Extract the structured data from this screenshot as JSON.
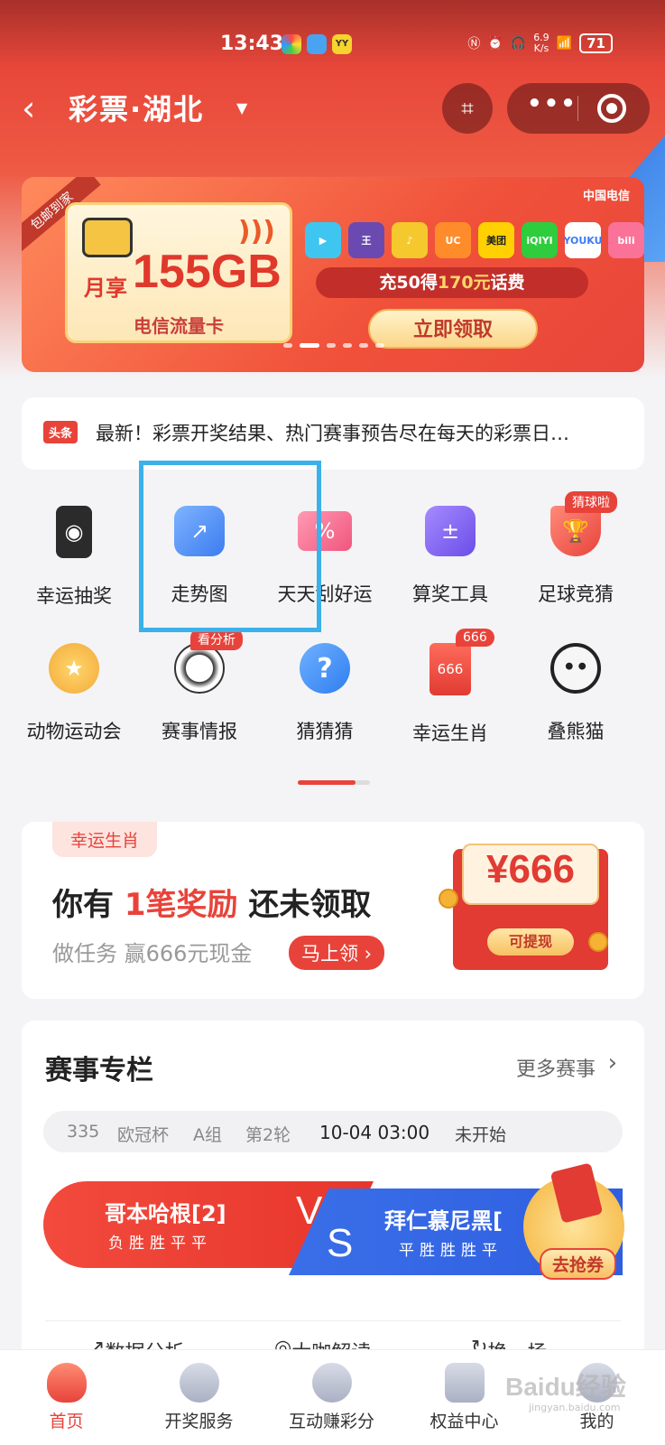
{
  "status_bar": {
    "time": "13:43",
    "net_speed": "6.9",
    "net_unit": "K/s",
    "battery": "71"
  },
  "nav": {
    "title": "彩票·湖北"
  },
  "banner": {
    "ribbon": "包邮到家",
    "monthly": "月享",
    "data_amount": "155GB",
    "card_name": "电信流量卡",
    "carrier": "中国电信",
    "apps": [
      "腾讯视频",
      "王者",
      "QQ音乐",
      "UC",
      "美团",
      "爱奇艺",
      "优酷",
      "bilibili"
    ],
    "promo_prefix": "充50得",
    "promo_highlight": "170元",
    "promo_suffix": "话费",
    "cta": "立即领取"
  },
  "headline": {
    "tag": "头条",
    "text": "最新！彩票开奖结果、热门赛事预告尽在每天的彩票日…"
  },
  "grid": [
    {
      "label": "幸运抽奖",
      "icon": "phone-icon",
      "color": "#2b2b2b"
    },
    {
      "label": "走势图",
      "icon": "trend-chart-icon",
      "color": "#4f8ff0"
    },
    {
      "label": "天天刮好运",
      "icon": "scratch-card-icon",
      "color": "#f06a8a"
    },
    {
      "label": "算奖工具",
      "icon": "calculator-icon",
      "color": "#7a5cf0"
    },
    {
      "label": "足球竞猜",
      "icon": "trophy-icon",
      "color": "#e8433a",
      "badge": "猜球啦"
    },
    {
      "label": "动物运动会",
      "icon": "medal-icon",
      "color": "#f3a93a"
    },
    {
      "label": "赛事情报",
      "icon": "soccer-ball-icon",
      "color": "#333333",
      "badge": "看分析"
    },
    {
      "label": "猜猜猜",
      "icon": "question-icon",
      "color": "#3a8ff0"
    },
    {
      "label": "幸运生肖",
      "icon": "red-packet-icon",
      "color": "#e8433a",
      "badge": "666",
      "inner": "666"
    },
    {
      "label": "叠熊猫",
      "icon": "panda-icon",
      "color": "#444444"
    }
  ],
  "reward": {
    "tag": "幸运生肖",
    "title_pre": "你有 ",
    "title_hl": "1笔奖励",
    "title_post": " 还未领取",
    "subtitle": "做任务 赢666元现金",
    "button": "马上领 ›",
    "amount": "¥666",
    "withdraw": "可提现"
  },
  "match": {
    "title": "赛事专栏",
    "more": "更多赛事",
    "info": {
      "no": "335",
      "league": "欧冠杯",
      "group": "A组",
      "round": "第2轮",
      "time": "10-04 03:00",
      "state": "未开始"
    },
    "home": {
      "name": "哥本哈根[2]",
      "form": "负胜胜平平"
    },
    "away": {
      "name": "拜仁慕尼黑[",
      "form": "平胜胜胜平"
    },
    "vs_v": "V",
    "vs_s": "S",
    "grab": "去抢券",
    "tabs": [
      "数据分析",
      "大咖解读",
      "换一场"
    ]
  },
  "bottom_nav": [
    {
      "label": "首页",
      "active": true
    },
    {
      "label": "开奖服务"
    },
    {
      "label": "互动赚彩分"
    },
    {
      "label": "权益中心"
    },
    {
      "label": "我的"
    }
  ],
  "watermark": {
    "brand": "Baidu经验",
    "url": "jingyan.baidu.com"
  },
  "colors": {
    "accent": "#e8433a",
    "highlight_box": "#3bb1ea",
    "away_blue": "#3a6fe8"
  }
}
